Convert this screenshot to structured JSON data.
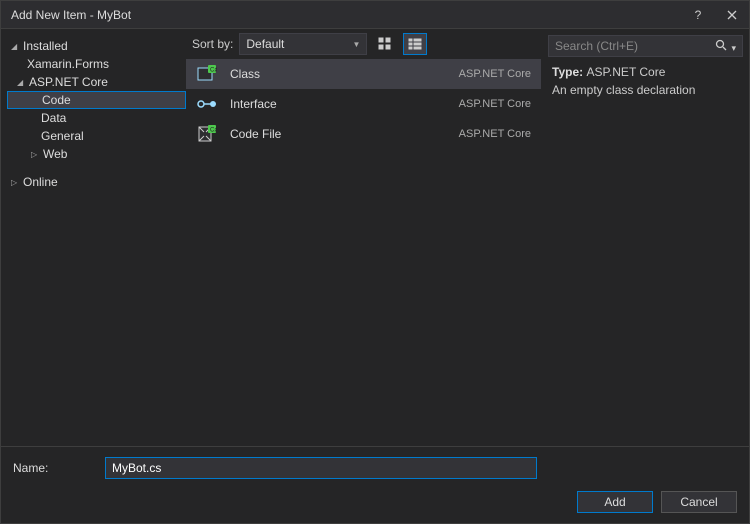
{
  "title": "Add New Item - MyBot",
  "sidebar": {
    "root": "Installed",
    "items": [
      {
        "label": "Xamarin.Forms"
      },
      {
        "label": "ASP.NET Core",
        "expanded": true,
        "children": [
          {
            "label": "Code",
            "selected": true
          },
          {
            "label": "Data"
          },
          {
            "label": "General"
          },
          {
            "label": "Web",
            "hasChildren": true
          }
        ]
      }
    ],
    "online": "Online"
  },
  "toolbar": {
    "sortLabel": "Sort by:",
    "sortValue": "Default"
  },
  "templates": [
    {
      "label": "Class",
      "tag": "ASP.NET Core",
      "selected": true,
      "icon": "class"
    },
    {
      "label": "Interface",
      "tag": "ASP.NET Core",
      "icon": "interface"
    },
    {
      "label": "Code File",
      "tag": "ASP.NET Core",
      "icon": "codefile"
    }
  ],
  "right": {
    "searchPlaceholder": "Search (Ctrl+E)",
    "typeLabel": "Type:",
    "typeValue": "ASP.NET Core",
    "description": "An empty class declaration"
  },
  "footer": {
    "nameLabel": "Name:",
    "nameValue": "MyBot.cs",
    "addLabel": "Add",
    "cancelLabel": "Cancel"
  }
}
